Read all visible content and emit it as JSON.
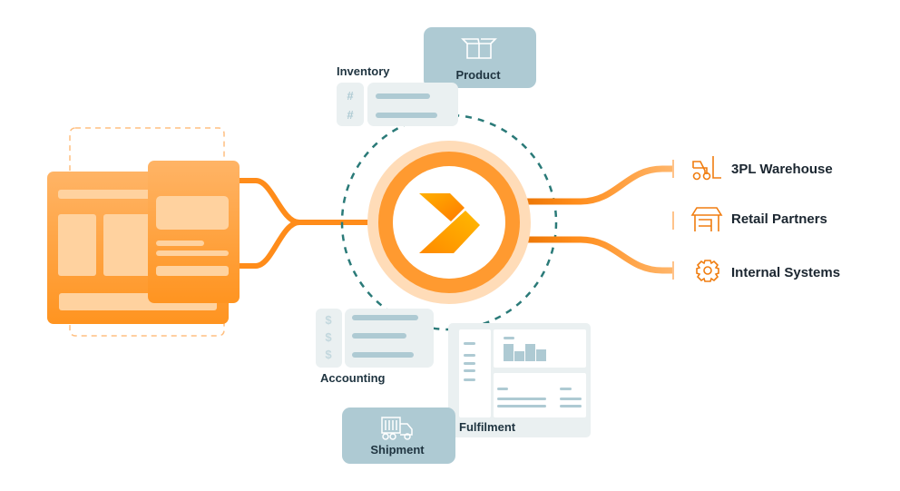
{
  "colors": {
    "orange": "#ff8c1a",
    "orange_light": "#ffd09b",
    "teal_dashed": "#2a7a78",
    "card_blue": "#aecad3",
    "card_gray": "#eaf0f1",
    "text_dark": "#1f3440"
  },
  "modules": {
    "product": {
      "label": "Product",
      "icon": "open-box-icon"
    },
    "inventory": {
      "label": "Inventory",
      "icon": "hash-icon"
    },
    "accounting": {
      "label": "Accounting",
      "icon": "dollar-icon"
    },
    "fulfilment": {
      "label": "Fulfilment"
    },
    "shipment": {
      "label": "Shipment",
      "icon": "truck-icon"
    }
  },
  "glyphs": {
    "hash": "#",
    "dollar": "$"
  },
  "destinations": [
    {
      "label": "3PL Warehouse",
      "icon": "forklift-icon"
    },
    {
      "label": "Retail Partners",
      "icon": "storefront-icon"
    },
    {
      "label": "Internal Systems",
      "icon": "gear-icon"
    }
  ]
}
